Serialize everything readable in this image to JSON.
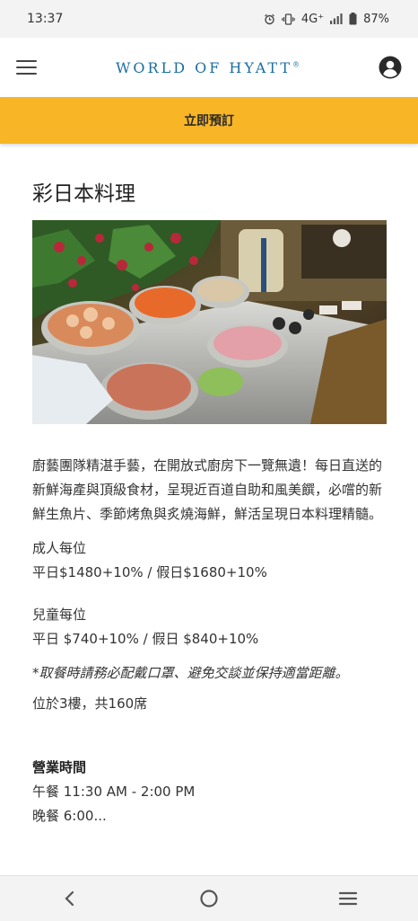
{
  "status_bar": {
    "time": "13:37",
    "network": "4G⁺",
    "battery": "87%",
    "icons": [
      "alarm-icon",
      "vibrate-icon",
      "signal-icon",
      "battery-icon"
    ]
  },
  "header": {
    "brand": "WORLD OF HYATT",
    "brand_mark": "®",
    "brand_color": "#1a6ea1",
    "menu_icon": "hamburger-menu-icon",
    "account_icon": "account-icon"
  },
  "booking": {
    "label": "立即預訂",
    "color": "#f8b526"
  },
  "restaurant": {
    "title": "彩日本料理",
    "description": "廚藝團隊精湛手藝，在開放式廚房下一覽無遺！每日直送的新鮮海產與頂級食材，呈現近百道自助和風美饌，必嚐的新鮮生魚片、季節烤魚與炙燒海鮮，鮮活呈現日本料理精髓。",
    "adult": {
      "label": "成人每位",
      "price": "平日$1480+10% / 假日$1680+10%"
    },
    "child": {
      "label": "兒童每位",
      "price": "平日 $740+10% / 假日 $840+10%"
    },
    "note": "*取餐時請務必配戴口罩、避免交談並保持適當距離。",
    "location": "位於3樓，共160席",
    "hours": {
      "heading": "營業時間",
      "lunch": "午餐 11:30 AM - 2:00 PM",
      "dinner": "晚餐 6:00..."
    }
  },
  "nav": {
    "back_icon": "back-icon",
    "home_icon": "home-icon",
    "recents_icon": "recents-icon"
  }
}
